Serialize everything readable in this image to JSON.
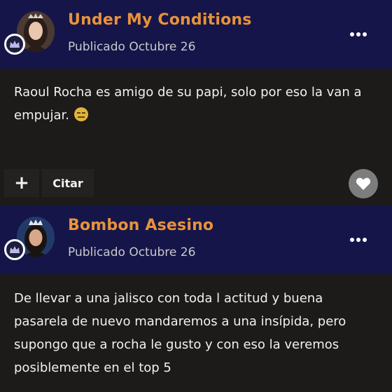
{
  "posts": [
    {
      "author": "Under My Conditions",
      "date": "Publicado Octubre 26",
      "body": "Raoul Rocha es amigo de su papi, solo por eso la van a empujar.",
      "emoji": "expressionless-face-emoji",
      "actions": {
        "plus": "+",
        "quote": "Citar",
        "like_icon": "heart-icon"
      }
    },
    {
      "author": "Bombon Asesino",
      "date": "Publicado Octubre 26",
      "body": "De llevar a una jalisco con toda l actitud y buena pasarela de nuevo mandaremos a una insípida, pero supongo que a rocha le gusto y con eso la veremos posiblemente en el top 5"
    }
  ],
  "colors": {
    "header_bg": "#15154a",
    "author": "#e8923a",
    "body_bg": "#1c1b1a"
  }
}
